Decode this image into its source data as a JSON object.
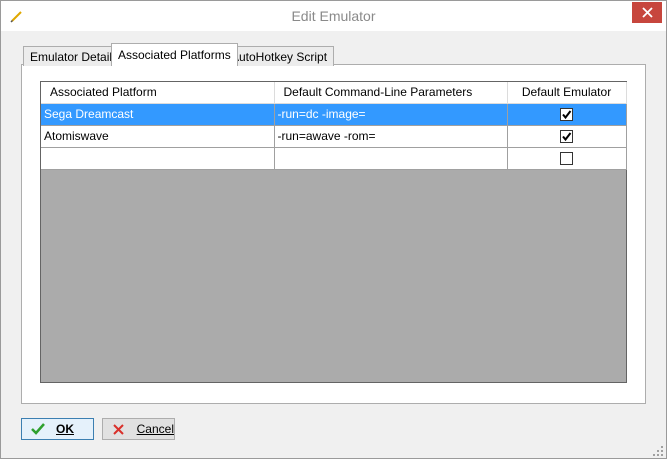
{
  "window": {
    "title": "Edit Emulator"
  },
  "tabs": [
    {
      "label": "Emulator Details",
      "active": false
    },
    {
      "label": "Associated Platforms",
      "active": true
    },
    {
      "label": "AutoHotkey Script",
      "active": false
    }
  ],
  "grid": {
    "columns": [
      "Associated Platform",
      "Default Command-Line Parameters",
      "Default Emulator"
    ],
    "rows": [
      {
        "platform": "Sega Dreamcast",
        "params": "-run=dc -image=",
        "default": true,
        "selected": true
      },
      {
        "platform": "Atomiswave",
        "params": "-run=awave -rom=",
        "default": true,
        "selected": false
      },
      {
        "platform": "",
        "params": "",
        "default": false,
        "selected": false
      }
    ]
  },
  "buttons": {
    "ok": "OK",
    "cancel": "Cancel"
  },
  "colors": {
    "selection": "#3399ff",
    "close": "#c7463d",
    "grid_bg": "#ababab"
  }
}
